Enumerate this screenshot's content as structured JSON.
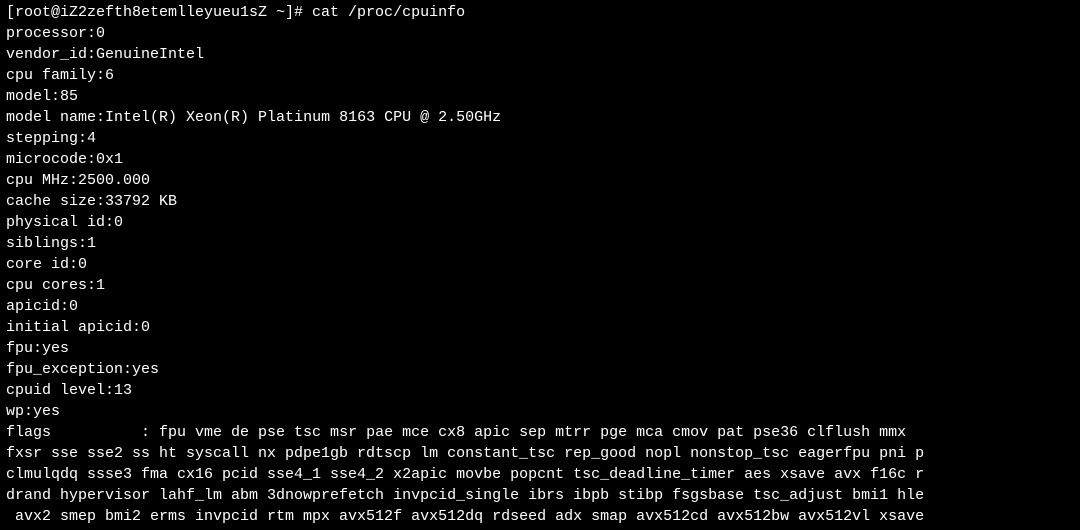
{
  "prompt": "[root@iZ2zefth8etemlleyueu1sZ ~]# cat /proc/cpuinfo",
  "fields": [
    {
      "key": "processor      ",
      "value": "0"
    },
    {
      "key": "vendor_id      ",
      "value": "GenuineIntel"
    },
    {
      "key": "cpu family     ",
      "value": "6"
    },
    {
      "key": "model          ",
      "value": "85"
    },
    {
      "key": "model name     ",
      "value": "Intel(R) Xeon(R) Platinum 8163 CPU @ 2.50GHz"
    },
    {
      "key": "stepping       ",
      "value": "4"
    },
    {
      "key": "microcode      ",
      "value": "0x1"
    },
    {
      "key": "cpu MHz        ",
      "value": "2500.000"
    },
    {
      "key": "cache size     ",
      "value": "33792 KB"
    },
    {
      "key": "physical id    ",
      "value": "0"
    },
    {
      "key": "siblings       ",
      "value": "1"
    },
    {
      "key": "core id        ",
      "value": "0"
    },
    {
      "key": "cpu cores      ",
      "value": "1"
    },
    {
      "key": "apicid         ",
      "value": "0"
    },
    {
      "key": "initial apicid ",
      "value": "0"
    },
    {
      "key": "fpu            ",
      "value": "yes"
    },
    {
      "key": "fpu_exception  ",
      "value": "yes"
    },
    {
      "key": "cpuid level    ",
      "value": "13"
    },
    {
      "key": "wp             ",
      "value": "yes"
    }
  ],
  "flags_key": "flags          ",
  "flags_lines": [
    ": fpu vme de pse tsc msr pae mce cx8 apic sep mtrr pge mca cmov pat pse36 clflush mmx ",
    "fxsr sse sse2 ss ht syscall nx pdpe1gb rdtscp lm constant_tsc rep_good nopl nonstop_tsc eagerfpu pni p",
    "clmulqdq ssse3 fma cx16 pcid sse4_1 sse4_2 x2apic movbe popcnt tsc_deadline_timer aes xsave avx f16c r",
    "drand hypervisor lahf_lm abm 3dnowprefetch invpcid_single ibrs ibpb stibp fsgsbase tsc_adjust bmi1 hle",
    " avx2 smep bmi2 erms invpcid rtm mpx avx512f avx512dq rdseed adx smap avx512cd avx512bw avx512vl xsave"
  ]
}
